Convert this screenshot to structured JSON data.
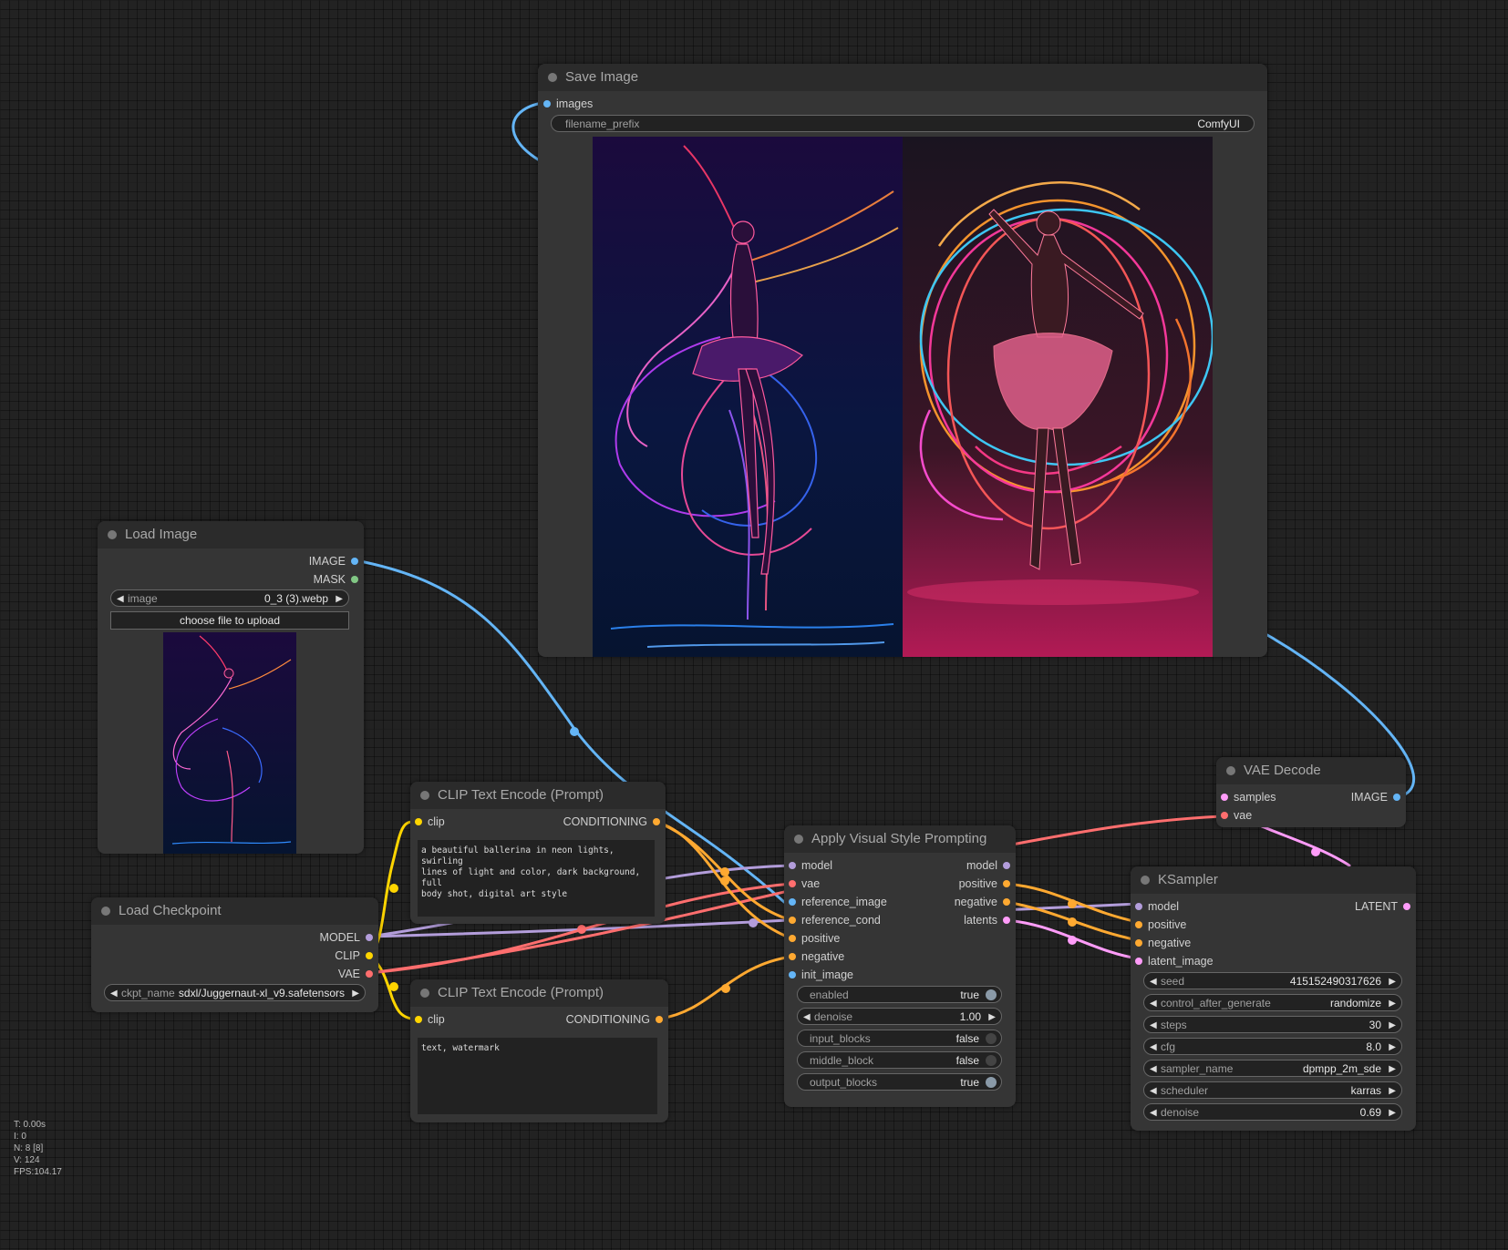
{
  "stats": {
    "t": "T: 0.00s",
    "i": "I: 0",
    "n": "N: 8 [8]",
    "v": "V: 124",
    "fps": "FPS:104.17"
  },
  "colors": {
    "model": "#b39ddb",
    "clip": "#ffd500",
    "vae": "#ff6e6e",
    "conditioning": "#ffa931",
    "image": "#64b5f6",
    "mask": "#81c784",
    "latent": "#ff9cf9"
  },
  "save_image": {
    "title": "Save Image",
    "in_images": "images",
    "filename_prefix_label": "filename_prefix",
    "filename_prefix_value": "ComfyUI"
  },
  "load_image": {
    "title": "Load Image",
    "out_image": "IMAGE",
    "out_mask": "MASK",
    "image_label": "image",
    "image_value": "0_3 (3).webp",
    "upload_button": "choose file to upload"
  },
  "load_checkpoint": {
    "title": "Load Checkpoint",
    "out_model": "MODEL",
    "out_clip": "CLIP",
    "out_vae": "VAE",
    "ckpt_label": "ckpt_name",
    "ckpt_value": "sdxl/Juggernaut-xl_v9.safetensors"
  },
  "clip_pos": {
    "title": "CLIP Text Encode (Prompt)",
    "in_clip": "clip",
    "out_cond": "CONDITIONING",
    "text": "a beautiful ballerina in neon lights, swirling\nlines of light and color, dark background, full\nbody shot, digital art style"
  },
  "clip_neg": {
    "title": "CLIP Text Encode (Prompt)",
    "in_clip": "clip",
    "out_cond": "CONDITIONING",
    "text": "text, watermark"
  },
  "apply_style": {
    "title": "Apply Visual Style Prompting",
    "in_model": "model",
    "in_vae": "vae",
    "in_reference_image": "reference_image",
    "in_reference_cond": "reference_cond",
    "in_positive": "positive",
    "in_negative": "negative",
    "in_init_image": "init_image",
    "out_model": "model",
    "out_positive": "positive",
    "out_negative": "negative",
    "out_latents": "latents",
    "enabled_label": "enabled",
    "enabled_value": "true",
    "denoise_label": "denoise",
    "denoise_value": "1.00",
    "input_blocks_label": "input_blocks",
    "input_blocks_value": "false",
    "middle_block_label": "middle_block",
    "middle_block_value": "false",
    "output_blocks_label": "output_blocks",
    "output_blocks_value": "true"
  },
  "vae_decode": {
    "title": "VAE Decode",
    "in_samples": "samples",
    "in_vae": "vae",
    "out_image": "IMAGE"
  },
  "ksampler": {
    "title": "KSampler",
    "in_model": "model",
    "in_positive": "positive",
    "in_negative": "negative",
    "in_latent": "latent_image",
    "out_latent": "LATENT",
    "seed_label": "seed",
    "seed_value": "415152490317626",
    "control_label": "control_after_generate",
    "control_value": "randomize",
    "steps_label": "steps",
    "steps_value": "30",
    "cfg_label": "cfg",
    "cfg_value": "8.0",
    "sampler_label": "sampler_name",
    "sampler_value": "dpmpp_2m_sde",
    "scheduler_label": "scheduler",
    "scheduler_value": "karras",
    "denoise_label": "denoise",
    "denoise_value": "0.69"
  }
}
